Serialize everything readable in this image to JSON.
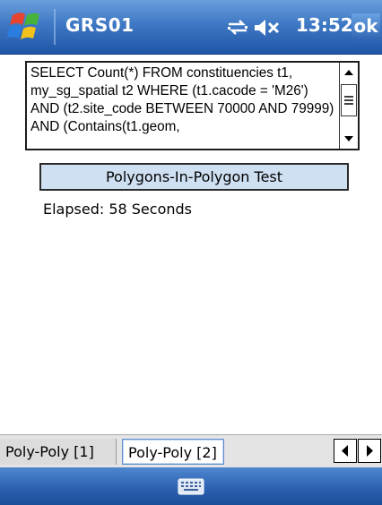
{
  "titlebar": {
    "title": "GRS01",
    "time": "13:52",
    "ok_label": "ok",
    "icons": [
      "windows-start-icon",
      "connectivity-icon",
      "volume-muted-icon"
    ]
  },
  "query": {
    "sql": "SELECT Count(*) FROM constituencies t1, my_sg_spatial t2 WHERE (t1.cacode = 'M26') AND (t2.site_code BETWEEN 70000 AND 79999) AND (Contains(t1.geom,"
  },
  "test": {
    "button_label": "Polygons-In-Polygon Test",
    "elapsed": "Elapsed: 58 Seconds"
  },
  "tabs": [
    {
      "label": "Poly-Poly [1]",
      "selected": false
    },
    {
      "label": "Poly-Poly [2]",
      "selected": true
    }
  ],
  "bottombar": {
    "icon": "keyboard-icon"
  },
  "colors": {
    "titlebar": "#3f78c4",
    "button_bg": "#cfe0f2",
    "tab_selected_border": "#5f8ecf"
  }
}
